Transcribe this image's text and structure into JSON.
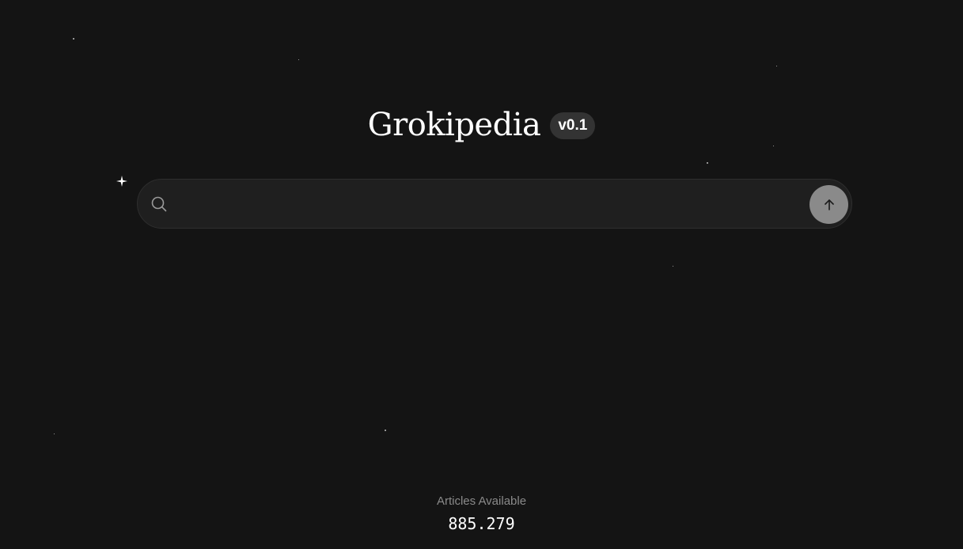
{
  "header": {
    "title": "Grokipedia",
    "version_badge": "v0.1"
  },
  "search": {
    "value": "",
    "placeholder": "",
    "submit_icon": "arrow-up-icon",
    "search_icon": "search-icon"
  },
  "stats": {
    "label": "Articles Available",
    "count": "885.279"
  },
  "colors": {
    "background": "#141414",
    "search_bar": "#1f1f1f",
    "submit_button": "#8a8a8a",
    "muted_text": "#8a8a8a",
    "text": "#ffffff"
  }
}
